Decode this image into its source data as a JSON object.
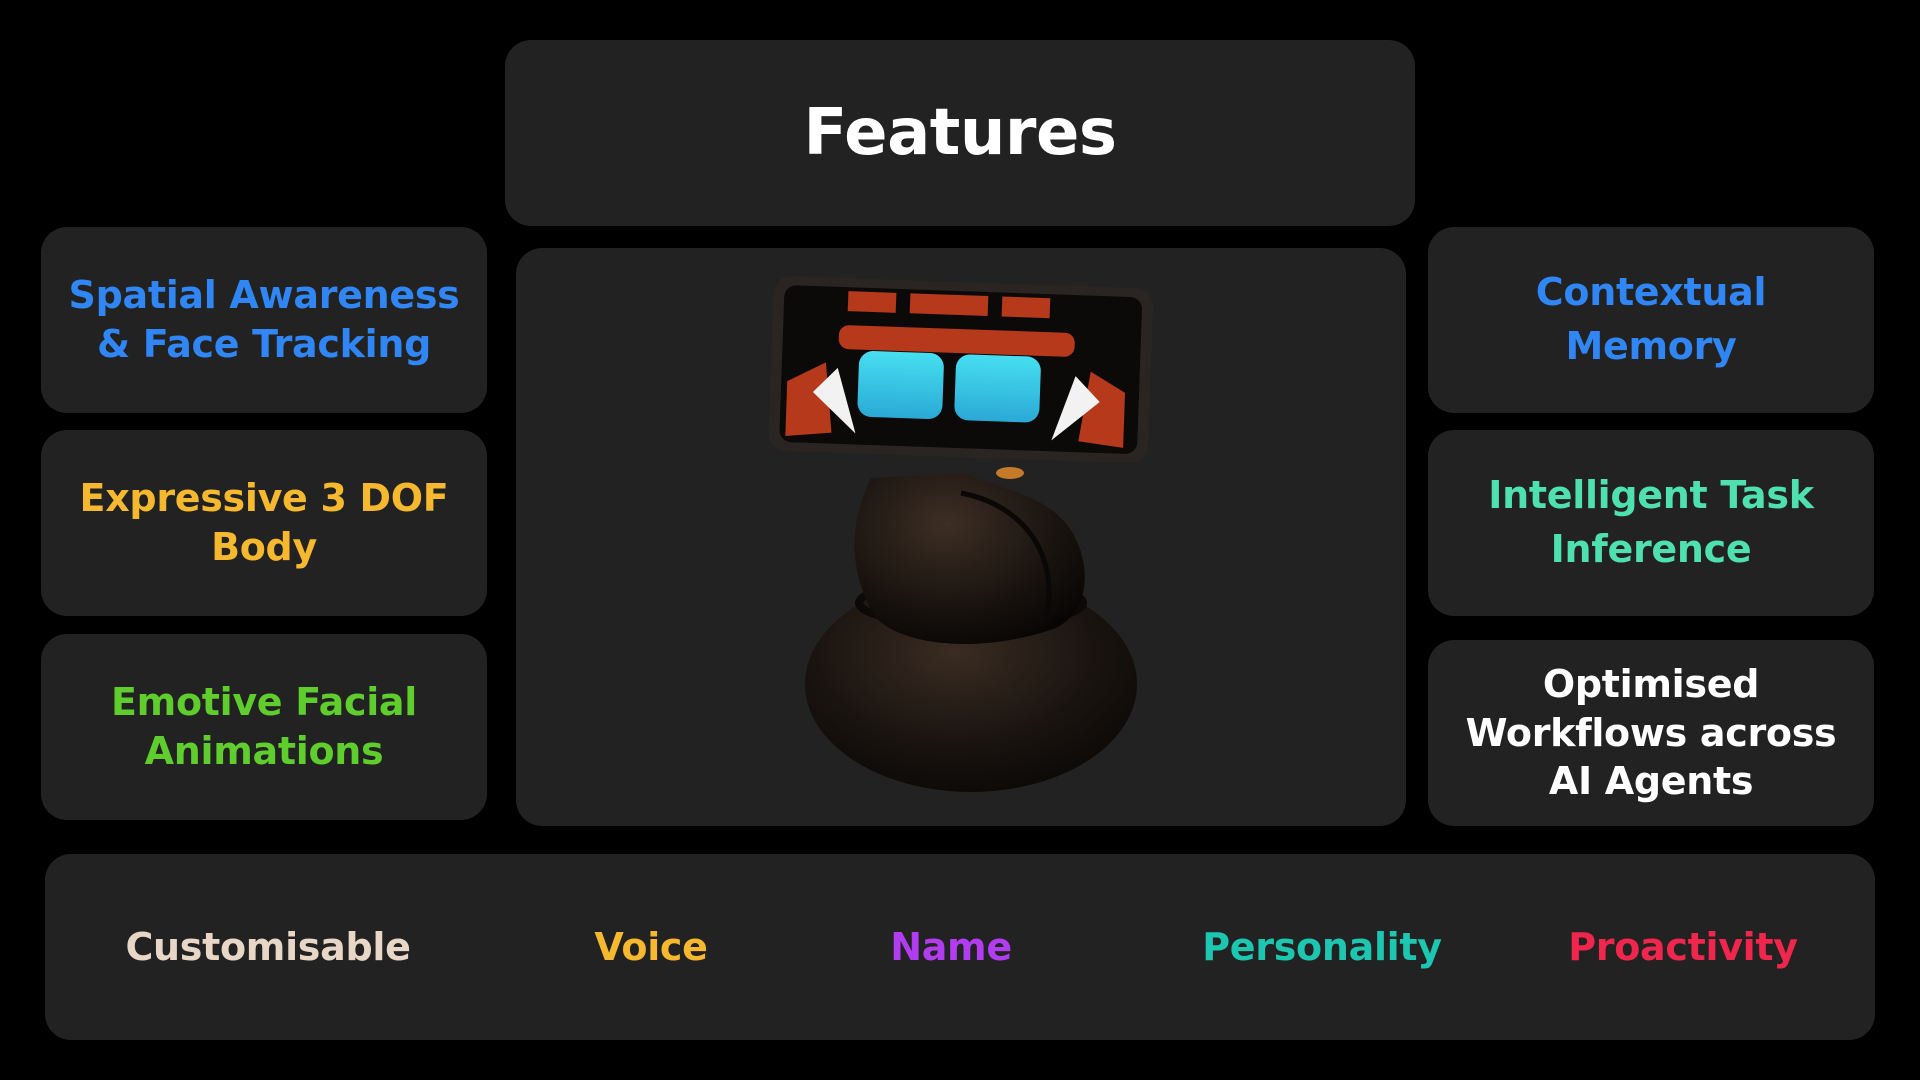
{
  "title": "Features",
  "left_features": [
    {
      "lines": [
        "Spatial Awareness",
        "& Face Tracking"
      ],
      "color": "#2f86f4"
    },
    {
      "lines": [
        "Expressive 3 DOF",
        "Body"
      ],
      "color": "#f5b82e"
    },
    {
      "lines": [
        "Emotive Facial",
        "Animations"
      ],
      "color": "#5fcd2c"
    }
  ],
  "right_features": [
    {
      "lines": [
        "Contextual",
        "Memory"
      ],
      "color": "#2f86f4"
    },
    {
      "lines": [
        "Intelligent Task",
        "Inference"
      ],
      "color": "#4fe0b0"
    },
    {
      "lines": [
        "Optimised",
        "Workflows across",
        "AI Agents"
      ],
      "color": "#ffffff"
    }
  ],
  "customisable": {
    "label": "Customisable",
    "label_color": "#e8d6c6",
    "items": [
      {
        "label": "Voice",
        "color": "#f5b82e"
      },
      {
        "label": "Name",
        "color": "#b13cf0"
      },
      {
        "label": "Personality",
        "color": "#1cc6b1"
      },
      {
        "label": "Proactivity",
        "color": "#f0264c"
      }
    ]
  },
  "robot": {
    "icon": "robot-image",
    "screen_accent": "#b5391a",
    "eye_color": "#3fd2e8"
  },
  "colors": {
    "background": "#000000",
    "card": "#222222"
  }
}
